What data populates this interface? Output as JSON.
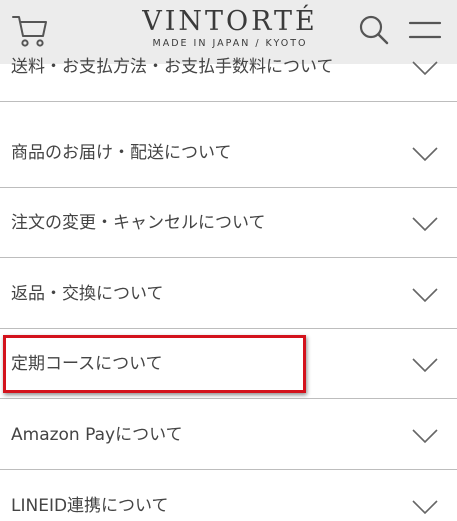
{
  "header": {
    "brand_name": "VINTORTÉ",
    "brand_tagline": "MADE IN JAPAN / KYOTO",
    "cart_icon": "cart-icon",
    "search_icon": "search-icon",
    "menu_icon": "hamburger-menu-icon"
  },
  "faq": {
    "items": [
      {
        "label": "送料・お支払方法・お支払手数料について"
      },
      {
        "label": "商品のお届け・配送について"
      },
      {
        "label": "注文の変更・キャンセルについて"
      },
      {
        "label": "返品・交換について"
      },
      {
        "label": "定期コースについて"
      },
      {
        "label": "Amazon Payについて"
      },
      {
        "label": "LINEID連携について"
      }
    ],
    "chevron_icon": "chevron-down-icon"
  },
  "annotation": {
    "highlight_color": "#d3121c"
  },
  "colors": {
    "header_bg": "#ececec",
    "divider": "#bdbdbd",
    "text": "#444444"
  }
}
